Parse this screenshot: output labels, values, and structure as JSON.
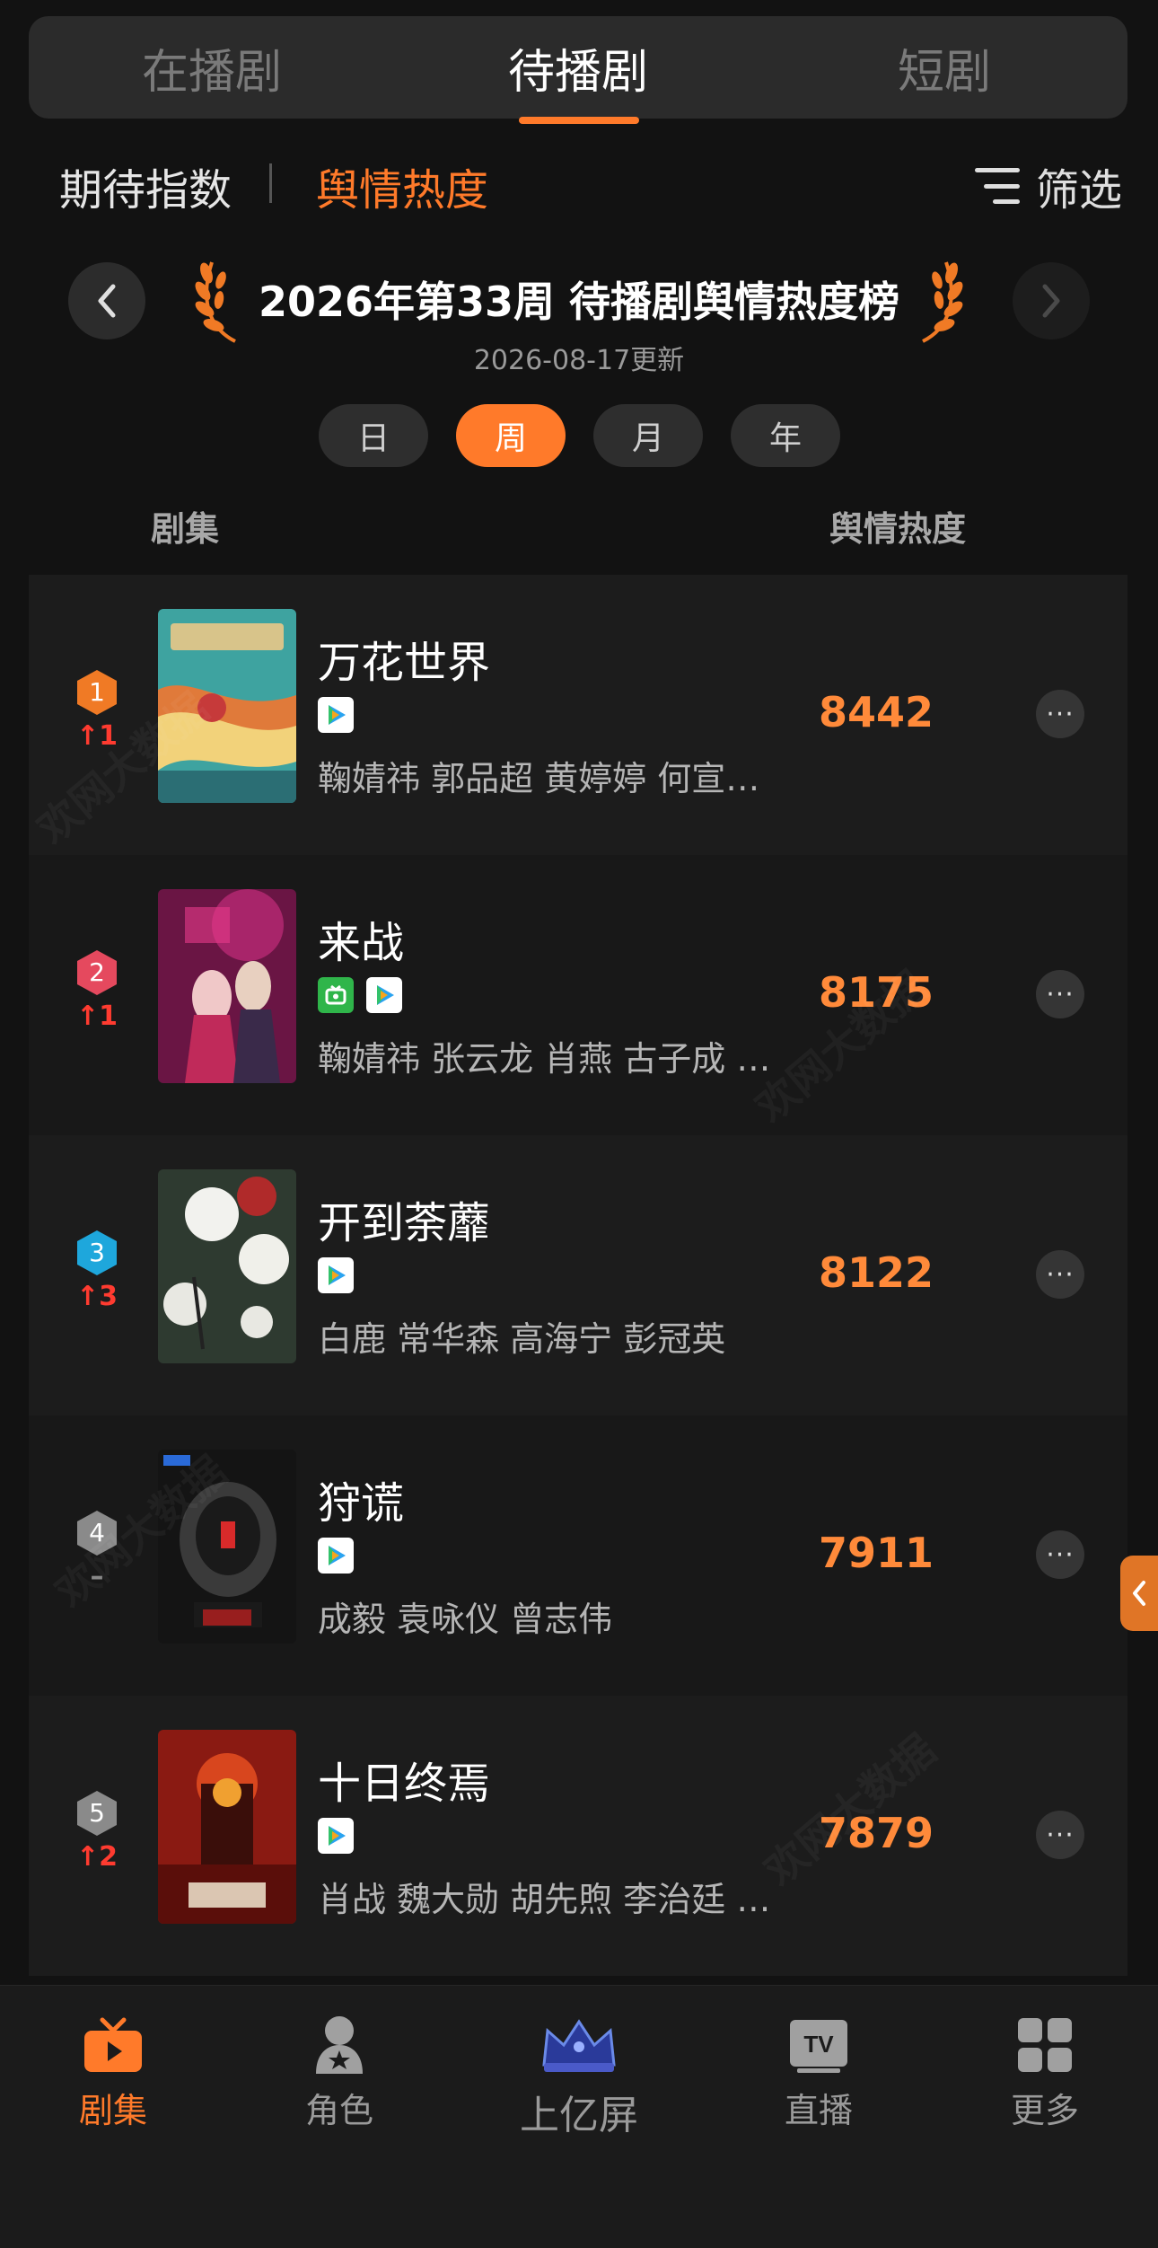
{
  "top_tabs": [
    "在播剧",
    "待播剧",
    "短剧"
  ],
  "active_top_tab": "待播剧",
  "sub_tabs": {
    "left": "期待指数",
    "right": "舆情热度"
  },
  "filter_label": "筛选",
  "chart_header": {
    "title": "2026年第33周 待播剧舆情热度榜",
    "updated": "2026-08-17更新"
  },
  "periods": [
    "日",
    "周",
    "月",
    "年"
  ],
  "active_period": "周",
  "columns": {
    "left": "剧集",
    "right": "舆情热度"
  },
  "rows": [
    {
      "rank": "1",
      "change": "↑1",
      "title": "万花世界",
      "platforms": [
        "tencent-video-icon"
      ],
      "cast": "鞠婧祎 郭品超 黄婷婷 何宣林 刘宇宁",
      "score": "8442",
      "badge_color": "#f07a25"
    },
    {
      "rank": "2",
      "change": "↑1",
      "title": "来战",
      "platforms": [
        "iqiyi-icon",
        "tencent-video-icon"
      ],
      "cast": "鞠婧祎 张云龙 肖燕 古子成 刘些宁",
      "score": "8175",
      "badge_color": "#e5495e"
    },
    {
      "rank": "3",
      "change": "↑3",
      "title": "开到荼蘼",
      "platforms": [
        "tencent-video-icon"
      ],
      "cast": "白鹿 常华森 高海宁 彭冠英",
      "score": "8122",
      "badge_color": "#1ea7dc"
    },
    {
      "rank": "4",
      "change": "–",
      "title": "狩谎",
      "platforms": [
        "tencent-video-icon"
      ],
      "cast": "成毅 袁咏仪 曾志伟",
      "score": "7911",
      "badge_color": "#8a8a8a"
    },
    {
      "rank": "5",
      "change": "↑2",
      "title": "十日终焉",
      "platforms": [
        "tencent-video-icon"
      ],
      "cast": "肖战 魏大勋 胡先煦 李治廷 张天爱",
      "score": "7879",
      "badge_color": "#8a8a8a"
    }
  ],
  "watermark": "欢网大数据",
  "bottom_nav": [
    {
      "label": "剧集",
      "icon": "tv-icon",
      "active": true
    },
    {
      "label": "角色",
      "icon": "person-star-icon",
      "active": false
    },
    {
      "label": "上亿屏",
      "icon": "crown-icon",
      "active": false
    },
    {
      "label": "直播",
      "icon": "tv-live-icon",
      "active": false
    },
    {
      "label": "更多",
      "icon": "grid-icon",
      "active": false
    }
  ],
  "colors": {
    "accent": "#ff7a2a",
    "score": "#ff8a3a",
    "rank_up": "#ff3b30"
  }
}
